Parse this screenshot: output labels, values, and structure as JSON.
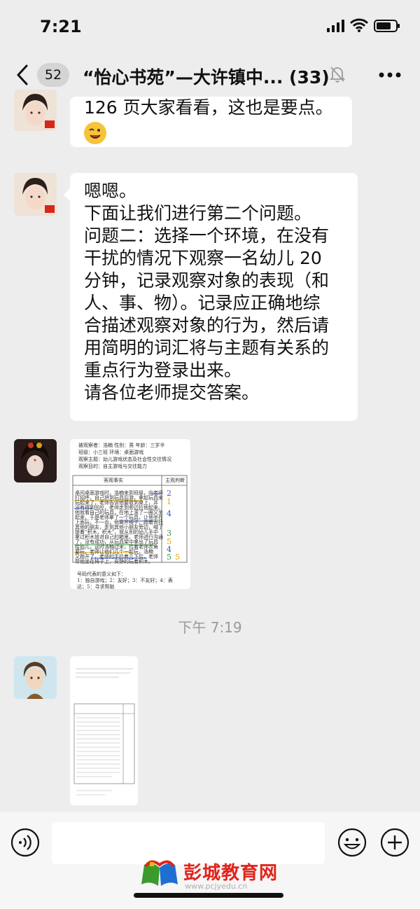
{
  "status": {
    "time": "7:21"
  },
  "header": {
    "back_count": "52",
    "title": "“怡心书苑”—大许镇中... (33)"
  },
  "messages": [
    {
      "lines": [
        "126 页大家看看，这也是要点。"
      ]
    },
    {
      "lines": [
        "嗯嗯。",
        "下面让我们进行第二个问题。",
        "问题二：选择一个环境，在没有",
        "干扰的情况下观察一名幼儿 20",
        "分钟，记录观察对象的表现（和",
        "人、事、物）。记录应正确地综",
        "合描述观察对象的行为，然后请",
        "用简明的词汇将与主题有关系的",
        "重点行为登录出来。",
        "请各位老师提交答案。"
      ]
    }
  ],
  "image1": {
    "head": [
      "被观察者：浩楠  性别：男  年龄：三岁半",
      "班级：小三班  环境：桌面游戏",
      "观察主题：幼儿游戏状态及社会性交往情况",
      "观察目的：自主游戏与交往能力"
    ],
    "col_left": "客观事实",
    "col_right": "主观判断",
    "body": [
      "桌间桌面游戏时，浩楠来到班级，向老师",
      "打招呼，自己拼到玩具后游，拿起玩具来",
      "玩起来了，老师告诉他要收到桌上，并",
      "没有得到回应，老师走到旁边拉他起来。",
      "他就看自己的玩具，在地上滚了一圈又坐",
      "起来，于是老师拿了一个玩具，让他坐在",
      "上面玩，不一会，他离开椅子，跑着去找",
      "其他的朋友，走到其他小朋友旁边，喊了",
      "提着“积木，积木”，就从别的幼儿手中",
      "拿过积木放进自己的箱里。老师进行沟通",
      "了，没有成功，从玩具架中拿出了玩具",
      "给幼儿，这时浩楠过来，拉着老师衣角",
      "要玩，老师让他们几个一起玩，浩楠",
      "又跑开了，老师的手拉着几下后，老师",
      "帮他坐在椅子上，安静的玩着积木。"
    ],
    "marks": [
      "2",
      "1",
      "4",
      "3",
      "5",
      "4",
      "5",
      "5"
    ],
    "legend": [
      "号码代表的意义如下：",
      "1：独自游戏；2：友好；3：不友好；4：表",
      "达；5：寻求帮助"
    ]
  },
  "timestamp": "下午 7:19",
  "watermark": {
    "name": "彭城教育网",
    "url": "www.pcjyedu.cn"
  },
  "colors": {
    "background": "#ededed",
    "bubble": "#ffffff",
    "watermark": "#e2231a"
  }
}
